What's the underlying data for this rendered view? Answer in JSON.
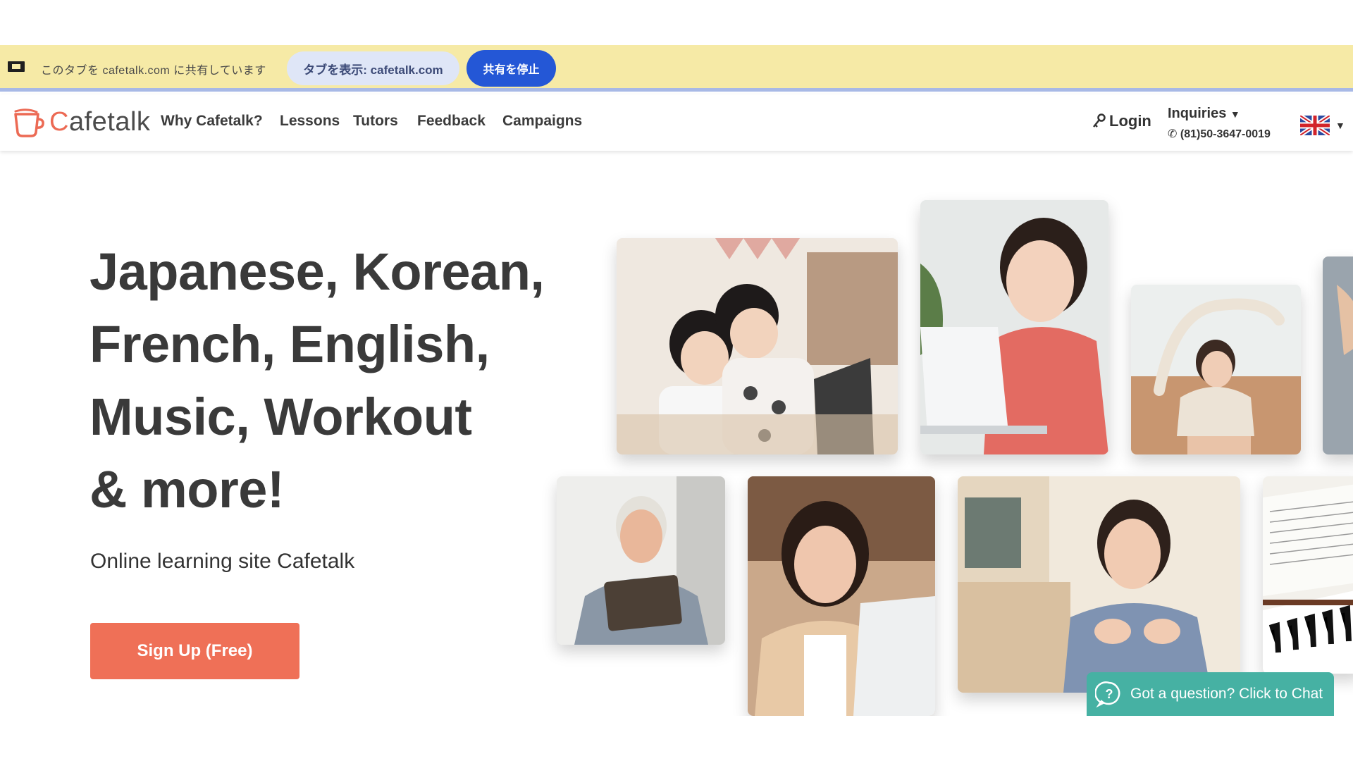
{
  "share_banner": {
    "message": "このタブを cafetalk.com に共有しています",
    "show_tab_label": "タブを表示: cafetalk.com",
    "stop_sharing_label": "共有を停止",
    "icon": "screen-share-icon"
  },
  "nav": {
    "logo_text": "Cafetalk",
    "links": [
      "Why Cafetalk?",
      "Lessons",
      "Tutors",
      "Feedback",
      "Campaigns"
    ],
    "login_label": "Login",
    "login_icon": "key-icon",
    "inquiries_label": "Inquiries",
    "phone": "(81)50-3647-0019",
    "language_flag": "uk-flag-icon"
  },
  "hero": {
    "title_lines": [
      "Japanese, Korean,",
      "French, English,",
      "Music, Workout",
      "& more!"
    ],
    "subtitle": "Online learning site Cafetalk",
    "cta_label": "Sign Up (Free)"
  },
  "chat": {
    "label": "Got a question? Click to Chat",
    "icon": "chat-question-icon"
  },
  "colors": {
    "brand_orange": "#ef7057",
    "banner_yellow": "#f6eaa6",
    "stop_button_blue": "#2457d6",
    "chat_teal": "#46b1a3"
  }
}
